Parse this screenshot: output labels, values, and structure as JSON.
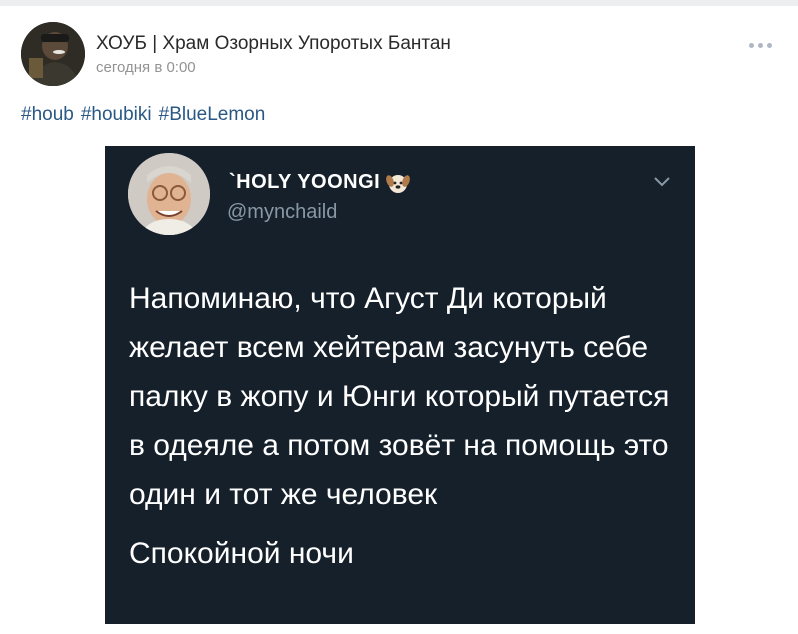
{
  "post": {
    "author": "ХОУБ | Храм Озорных Упоротых Бантан",
    "time": "сегодня в 0:00",
    "menu_icon": "more-horizontal-icon",
    "hashtags": [
      "#houb",
      "#houbiki",
      "#BlueLemon"
    ]
  },
  "tweet": {
    "name": "`HOLY YOONGI",
    "name_emoji": "dog-face-icon",
    "handle": "@mynchaild",
    "menu_icon": "chevron-down-icon",
    "text": "Напоминаю, что Агуст Ди который желает всем хейтерам засунуть себе палку в жопу и Юнги который путается в одеяле а потом зовёт на помощь это один и тот же человек",
    "text2": "Спокойной ночи"
  },
  "colors": {
    "link": "#2a5885",
    "author": "#2a2a2a",
    "meta": "#939393",
    "tweet_bg": "#15202b",
    "tweet_handle": "#8899a6"
  }
}
